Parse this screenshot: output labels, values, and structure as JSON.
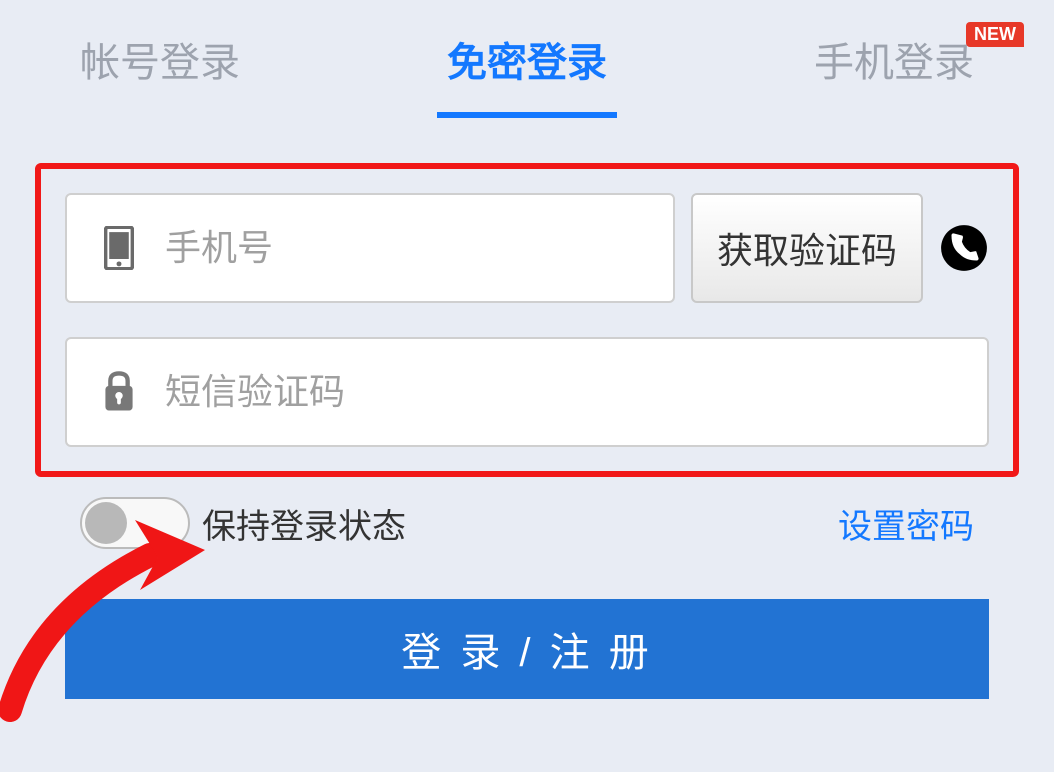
{
  "tabs": {
    "account": "帐号登录",
    "passwordless": "免密登录",
    "phone": "手机登录",
    "new_badge": "NEW"
  },
  "form": {
    "phone_placeholder": "手机号",
    "get_code_label": "获取验证码",
    "sms_code_placeholder": "短信验证码"
  },
  "options": {
    "keep_logged_in": "保持登录状态",
    "set_password": "设置密码"
  },
  "submit_label": "登 录 / 注 册"
}
